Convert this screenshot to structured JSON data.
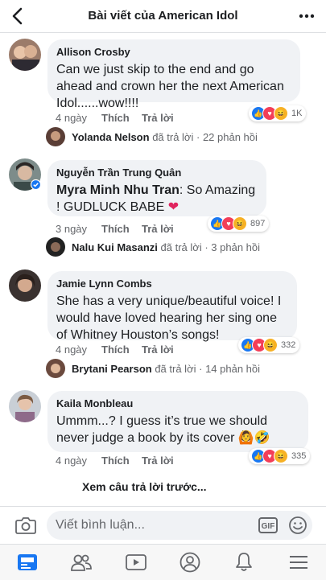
{
  "header": {
    "title": "Bài viết của American Idol"
  },
  "comments": [
    {
      "author": "Allison Crosby",
      "text": "Can we just skip to the end and go ahead and crown her the next American Idol......wow!!!!",
      "time": "4 ngày",
      "like": "Thích",
      "reply": "Trả lời",
      "reaction_count": "1K",
      "replier": "Yolanda Nelson",
      "replied": "đã trả lời",
      "sep": "·",
      "reply_count": "22 phản hồi"
    },
    {
      "author": "Nguyễn Trần Trung Quân",
      "mention": "Myra Minh Nhu Tran",
      "text": ": So Amazing ! GUDLUCK BABE",
      "time": "3 ngày",
      "like": "Thích",
      "reply": "Trả lời",
      "reaction_count": "897",
      "replier": "Nalu Kui Masanzi",
      "replied": "đã trả lời",
      "sep": "·",
      "reply_count": "3 phản hồi"
    },
    {
      "author": "Jamie Lynn Combs",
      "text": "She has a very unique/beautiful voice! I would have loved hearing her sing one of Whitney Houston’s songs!",
      "time": "4 ngày",
      "like": "Thích",
      "reply": "Trả lời",
      "reaction_count": "332",
      "replier": "Brytani Pearson",
      "replied": "đã trả lời",
      "sep": "·",
      "reply_count": "14 phản hồi"
    },
    {
      "author": "Kaila Monbleau",
      "text": "Ummm...? I guess it’s true we should never judge a book by its cover",
      "time": "4 ngày",
      "like": "Thích",
      "reply": "Trả lời",
      "reaction_count": "335"
    }
  ],
  "view_previous": "Xem câu trả lời trước...",
  "composer": {
    "placeholder": "Viết bình luận...",
    "gif": "GIF"
  },
  "colors": {
    "accent": "#1877f2",
    "bubble": "#f0f2f5",
    "love": "#f33e58",
    "haha": "#f7b125"
  },
  "icons": [
    "back-arrow-icon",
    "more-icon",
    "camera-icon",
    "gif-icon",
    "emoji-icon",
    "news-feed-icon",
    "friends-icon",
    "watch-icon",
    "profile-icon",
    "notifications-icon",
    "menu-icon"
  ]
}
